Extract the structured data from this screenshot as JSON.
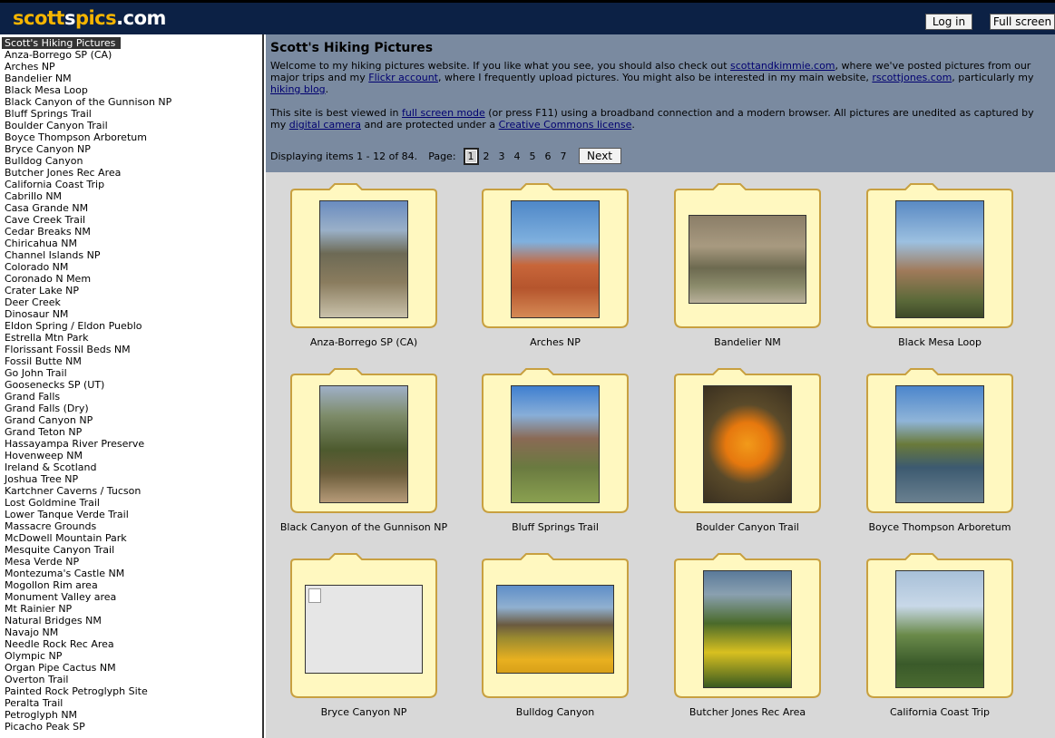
{
  "header": {
    "logo": {
      "part1": "scott",
      "part2": "s",
      "part3": "pics",
      "part4": ".com"
    },
    "login_label": "Log in",
    "fullscreen_label": "Full screen"
  },
  "sidebar": {
    "selected": "Scott's Hiking Pictures",
    "items": [
      "Anza-Borrego SP (CA)",
      "Arches NP",
      "Bandelier NM",
      "Black Mesa Loop",
      "Black Canyon of the Gunnison NP",
      "Bluff Springs Trail",
      "Boulder Canyon Trail",
      "Boyce Thompson Arboretum",
      "Bryce Canyon NP",
      "Bulldog Canyon",
      "Butcher Jones Rec Area",
      "California Coast Trip",
      "Cabrillo NM",
      "Casa Grande NM",
      "Cave Creek Trail",
      "Cedar Breaks NM",
      "Chiricahua NM",
      "Channel Islands NP",
      "Colorado NM",
      "Coronado N Mem",
      "Crater Lake NP",
      "Deer Creek",
      "Dinosaur NM",
      "Eldon Spring / Eldon Pueblo",
      "Estrella Mtn Park",
      "Florissant Fossil Beds NM",
      "Fossil Butte NM",
      "Go John Trail",
      "Goosenecks SP (UT)",
      "Grand Falls",
      "Grand Falls (Dry)",
      "Grand Canyon NP",
      "Grand Teton NP",
      "Hassayampa River Preserve",
      "Hovenweep NM",
      "Ireland & Scotland",
      "Joshua Tree NP",
      "Kartchner Caverns / Tucson",
      "Lost Goldmine Trail",
      "Lower Tanque Verde Trail",
      "Massacre Grounds",
      "McDowell Mountain Park",
      "Mesquite Canyon Trail",
      "Mesa Verde NP",
      "Montezuma's Castle NM",
      "Mogollon Rim area",
      "Monument Valley area",
      "Mt Rainier NP",
      "Natural Bridges NM",
      "Navajo NM",
      "Needle Rock Rec Area",
      "Olympic NP",
      "Organ Pipe Cactus NM",
      "Overton Trail",
      "Painted Rock Petroglyph Site",
      "Peralta Trail",
      "Petroglyph NM",
      "Picacho Peak SP"
    ]
  },
  "main": {
    "title": "Scott's Hiking Pictures",
    "intro1": {
      "t1": "Welcome to my hiking pictures website. If you like what you see, you should also check out ",
      "l1": "scottandkimmie.com",
      "t2": ", where we've posted pictures from our major trips and my ",
      "l2": "Flickr account",
      "t3": ", where I frequently upload pictures. You might also be interested in my main website, ",
      "l3": "rscottjones.com",
      "t4": ", particularly my ",
      "l4": "hiking blog",
      "t5": "."
    },
    "intro2": {
      "t1": "This site is best viewed in ",
      "l1": "full screen mode",
      "t2": " (or press F11) using a broadband connection and a modern browser. All pictures are unedited as captured by my ",
      "l2": "digital camera",
      "t3": " and are protected under a ",
      "l3": "Creative Commons license",
      "t4": "."
    },
    "pager": {
      "displaying": "Displaying items 1 - 12 of 84.",
      "page_label": "Page:",
      "pages": [
        "1",
        "2",
        "3",
        "4",
        "5",
        "6",
        "7"
      ],
      "current": "1",
      "next_label": "Next"
    },
    "tiles": [
      {
        "label": "Anza-Borrego SP (CA)"
      },
      {
        "label": "Arches NP"
      },
      {
        "label": "Bandelier NM"
      },
      {
        "label": "Black Mesa Loop"
      },
      {
        "label": "Black Canyon of the Gunnison NP"
      },
      {
        "label": "Bluff Springs Trail"
      },
      {
        "label": "Boulder Canyon Trail"
      },
      {
        "label": "Boyce Thompson Arboretum"
      },
      {
        "label": "Bryce Canyon NP"
      },
      {
        "label": "Bulldog Canyon"
      },
      {
        "label": "Butcher Jones Rec Area"
      },
      {
        "label": "California Coast Trip"
      }
    ]
  },
  "colors": {
    "header_bg": "#0c2145",
    "logo_accent": "#f4b400",
    "intro_bg": "#7a8aa0",
    "folder_fill": "#fff8c0",
    "folder_stroke": "#c8a040"
  }
}
